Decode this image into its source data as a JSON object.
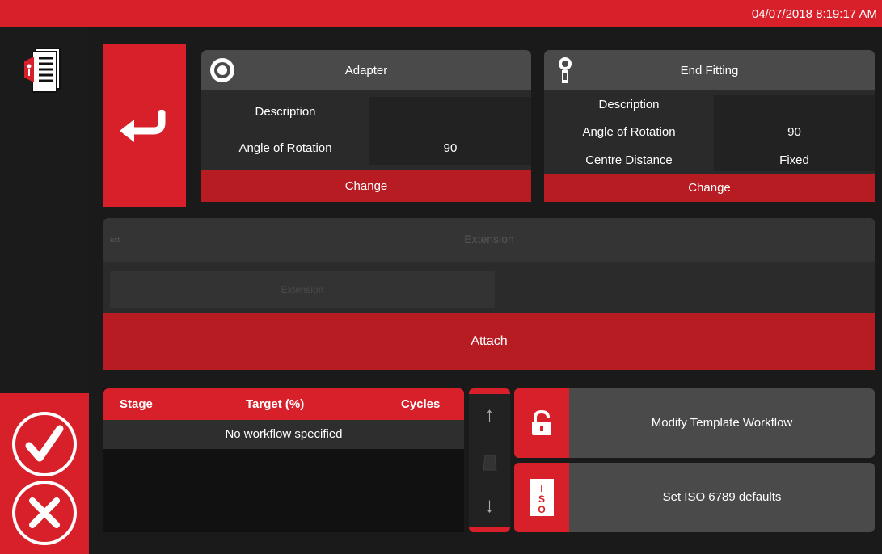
{
  "header": {
    "datetime": "04/07/2018 8:19:17 AM"
  },
  "icons": {
    "document": "document-icon",
    "back": "back-arrow-icon",
    "confirm": "check-circle-icon",
    "cancel": "x-circle-icon",
    "adapter": "adapter-ring-icon",
    "end_fitting": "end-fitting-icon",
    "lock": "unlock-icon",
    "iso": "iso-icon"
  },
  "colors": {
    "accent": "#d8202a",
    "accent_dark": "#b71c23",
    "panel": "#2a2a2a",
    "panel_header": "#4a4a4a"
  },
  "adapter": {
    "title": "Adapter",
    "description_label": "Description",
    "angle_label": "Angle of Rotation",
    "angle_value": "90",
    "change_label": "Change"
  },
  "end_fitting": {
    "title": "End Fitting",
    "description_label": "Description",
    "angle_label": "Angle of Rotation",
    "angle_value": "90",
    "centre_label": "Centre Distance",
    "centre_value": "Fixed",
    "change_label": "Change"
  },
  "extension": {
    "title": "Extension",
    "small_label": "ext",
    "field_text": "Extension"
  },
  "attach_label": "Attach",
  "workflow": {
    "columns": [
      "Stage",
      "Target (%)",
      "Cycles"
    ],
    "empty_text": "No workflow specified"
  },
  "scroll": {
    "up": "↑",
    "down": "↓"
  },
  "actions": {
    "modify": "Modify Template Workflow",
    "iso": "Set ISO 6789 defaults"
  }
}
